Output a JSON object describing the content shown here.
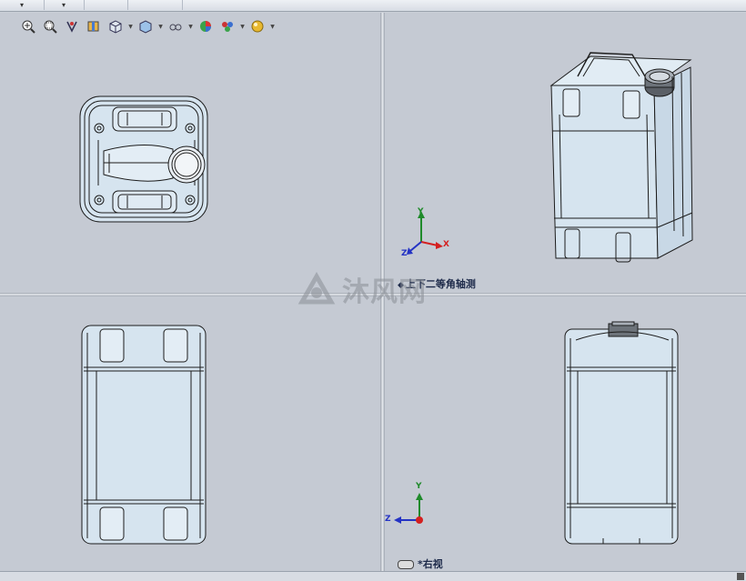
{
  "window": {
    "tabs": [
      "▾",
      "▾"
    ]
  },
  "toolbar": {
    "buttons": [
      {
        "name": "zoom-to-fit",
        "icon": "zoom-fit-icon"
      },
      {
        "name": "zoom-to-area",
        "icon": "zoom-area-icon"
      },
      {
        "name": "previous-view",
        "icon": "previous-view-icon"
      },
      {
        "name": "section-view",
        "icon": "section-view-icon"
      },
      {
        "name": "view-orientation",
        "icon": "view-orientation-icon",
        "dropdown": true
      },
      {
        "name": "display-style",
        "icon": "display-style-icon",
        "dropdown": true
      },
      {
        "name": "hide-show-items",
        "icon": "hide-show-icon",
        "dropdown": true
      },
      {
        "name": "edit-appearance",
        "icon": "appearance-icon"
      },
      {
        "name": "apply-scene",
        "icon": "scene-icon",
        "dropdown": true
      },
      {
        "name": "view-settings",
        "icon": "view-settings-icon",
        "dropdown": true
      }
    ]
  },
  "viewports": {
    "top_right_label": "上下二等角轴测",
    "bottom_right_label": "*右视"
  },
  "triad": {
    "x": "X",
    "y": "Y",
    "z": "Z"
  },
  "watermark": {
    "text": "沐风网"
  },
  "colors": {
    "viewport_bg": "#c5cad3",
    "part_fill": "#d6e4ef",
    "edge": "#1c1c1c",
    "axis_x": "#d42020",
    "axis_y": "#1f8a2a",
    "axis_z": "#2433c4"
  }
}
